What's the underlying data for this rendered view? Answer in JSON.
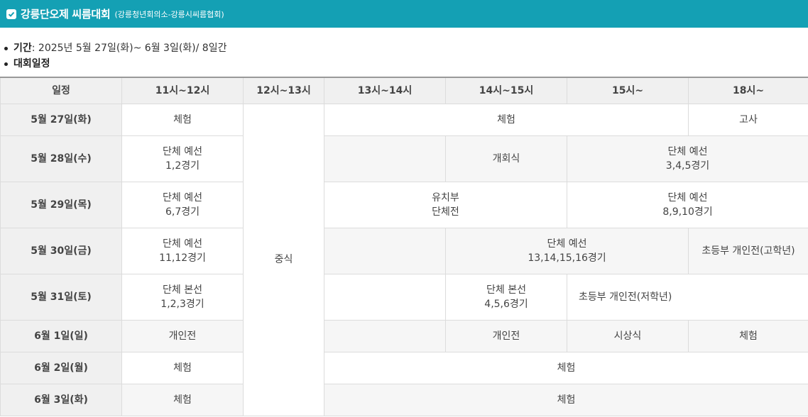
{
  "header": {
    "title": "강릉단오제 씨름대회",
    "org": "(강릉청년회의소-강릉시씨름협회)"
  },
  "info": {
    "period_label": "기간",
    "period_value": " : 2025년 5월 27일(화)~ 6월 3일(화)/ 8일간",
    "schedule_label": "대회일정"
  },
  "table": {
    "headers": [
      "일정",
      "11시~12시",
      "12시~13시",
      "13시~14시",
      "14시~15시",
      "15시~",
      "18시~"
    ],
    "lunch": "중식",
    "rows": [
      {
        "day": "5월 27일(화)",
        "c1": "체험",
        "c2": "체험",
        "c3": "고사"
      },
      {
        "day": "5월 28일(수)",
        "c1": "단체 예선\n1,2경기",
        "c2": "",
        "c3": "개회식",
        "c4": "단체 예선\n3,4,5경기"
      },
      {
        "day": "5월 29일(목)",
        "c1": "단체 예선\n6,7경기",
        "c2": "유치부\n단체전",
        "c3": "단체 예선\n8,9,10경기"
      },
      {
        "day": "5월 30일(금)",
        "c1": "단체 예선\n11,12경기",
        "c2": "",
        "c3": "단체 예선\n13,14,15,16경기",
        "c4": "초등부 개인전(고학년)"
      },
      {
        "day": "5월 31일(토)",
        "c1": "단체 본선\n1,2,3경기",
        "c2": "",
        "c3": "단체 본선\n4,5,6경기",
        "c4": "초등부 개인전(저학년)"
      },
      {
        "day": "6월 1일(일)",
        "c1": "개인전",
        "c2": "",
        "c3": "개인전",
        "c4": "시상식",
        "c5": "체험"
      },
      {
        "day": "6월 2일(월)",
        "c1": "체험",
        "c2": "체험"
      },
      {
        "day": "6월 3일(화)",
        "c1": "체험",
        "c2": "체험"
      }
    ]
  }
}
